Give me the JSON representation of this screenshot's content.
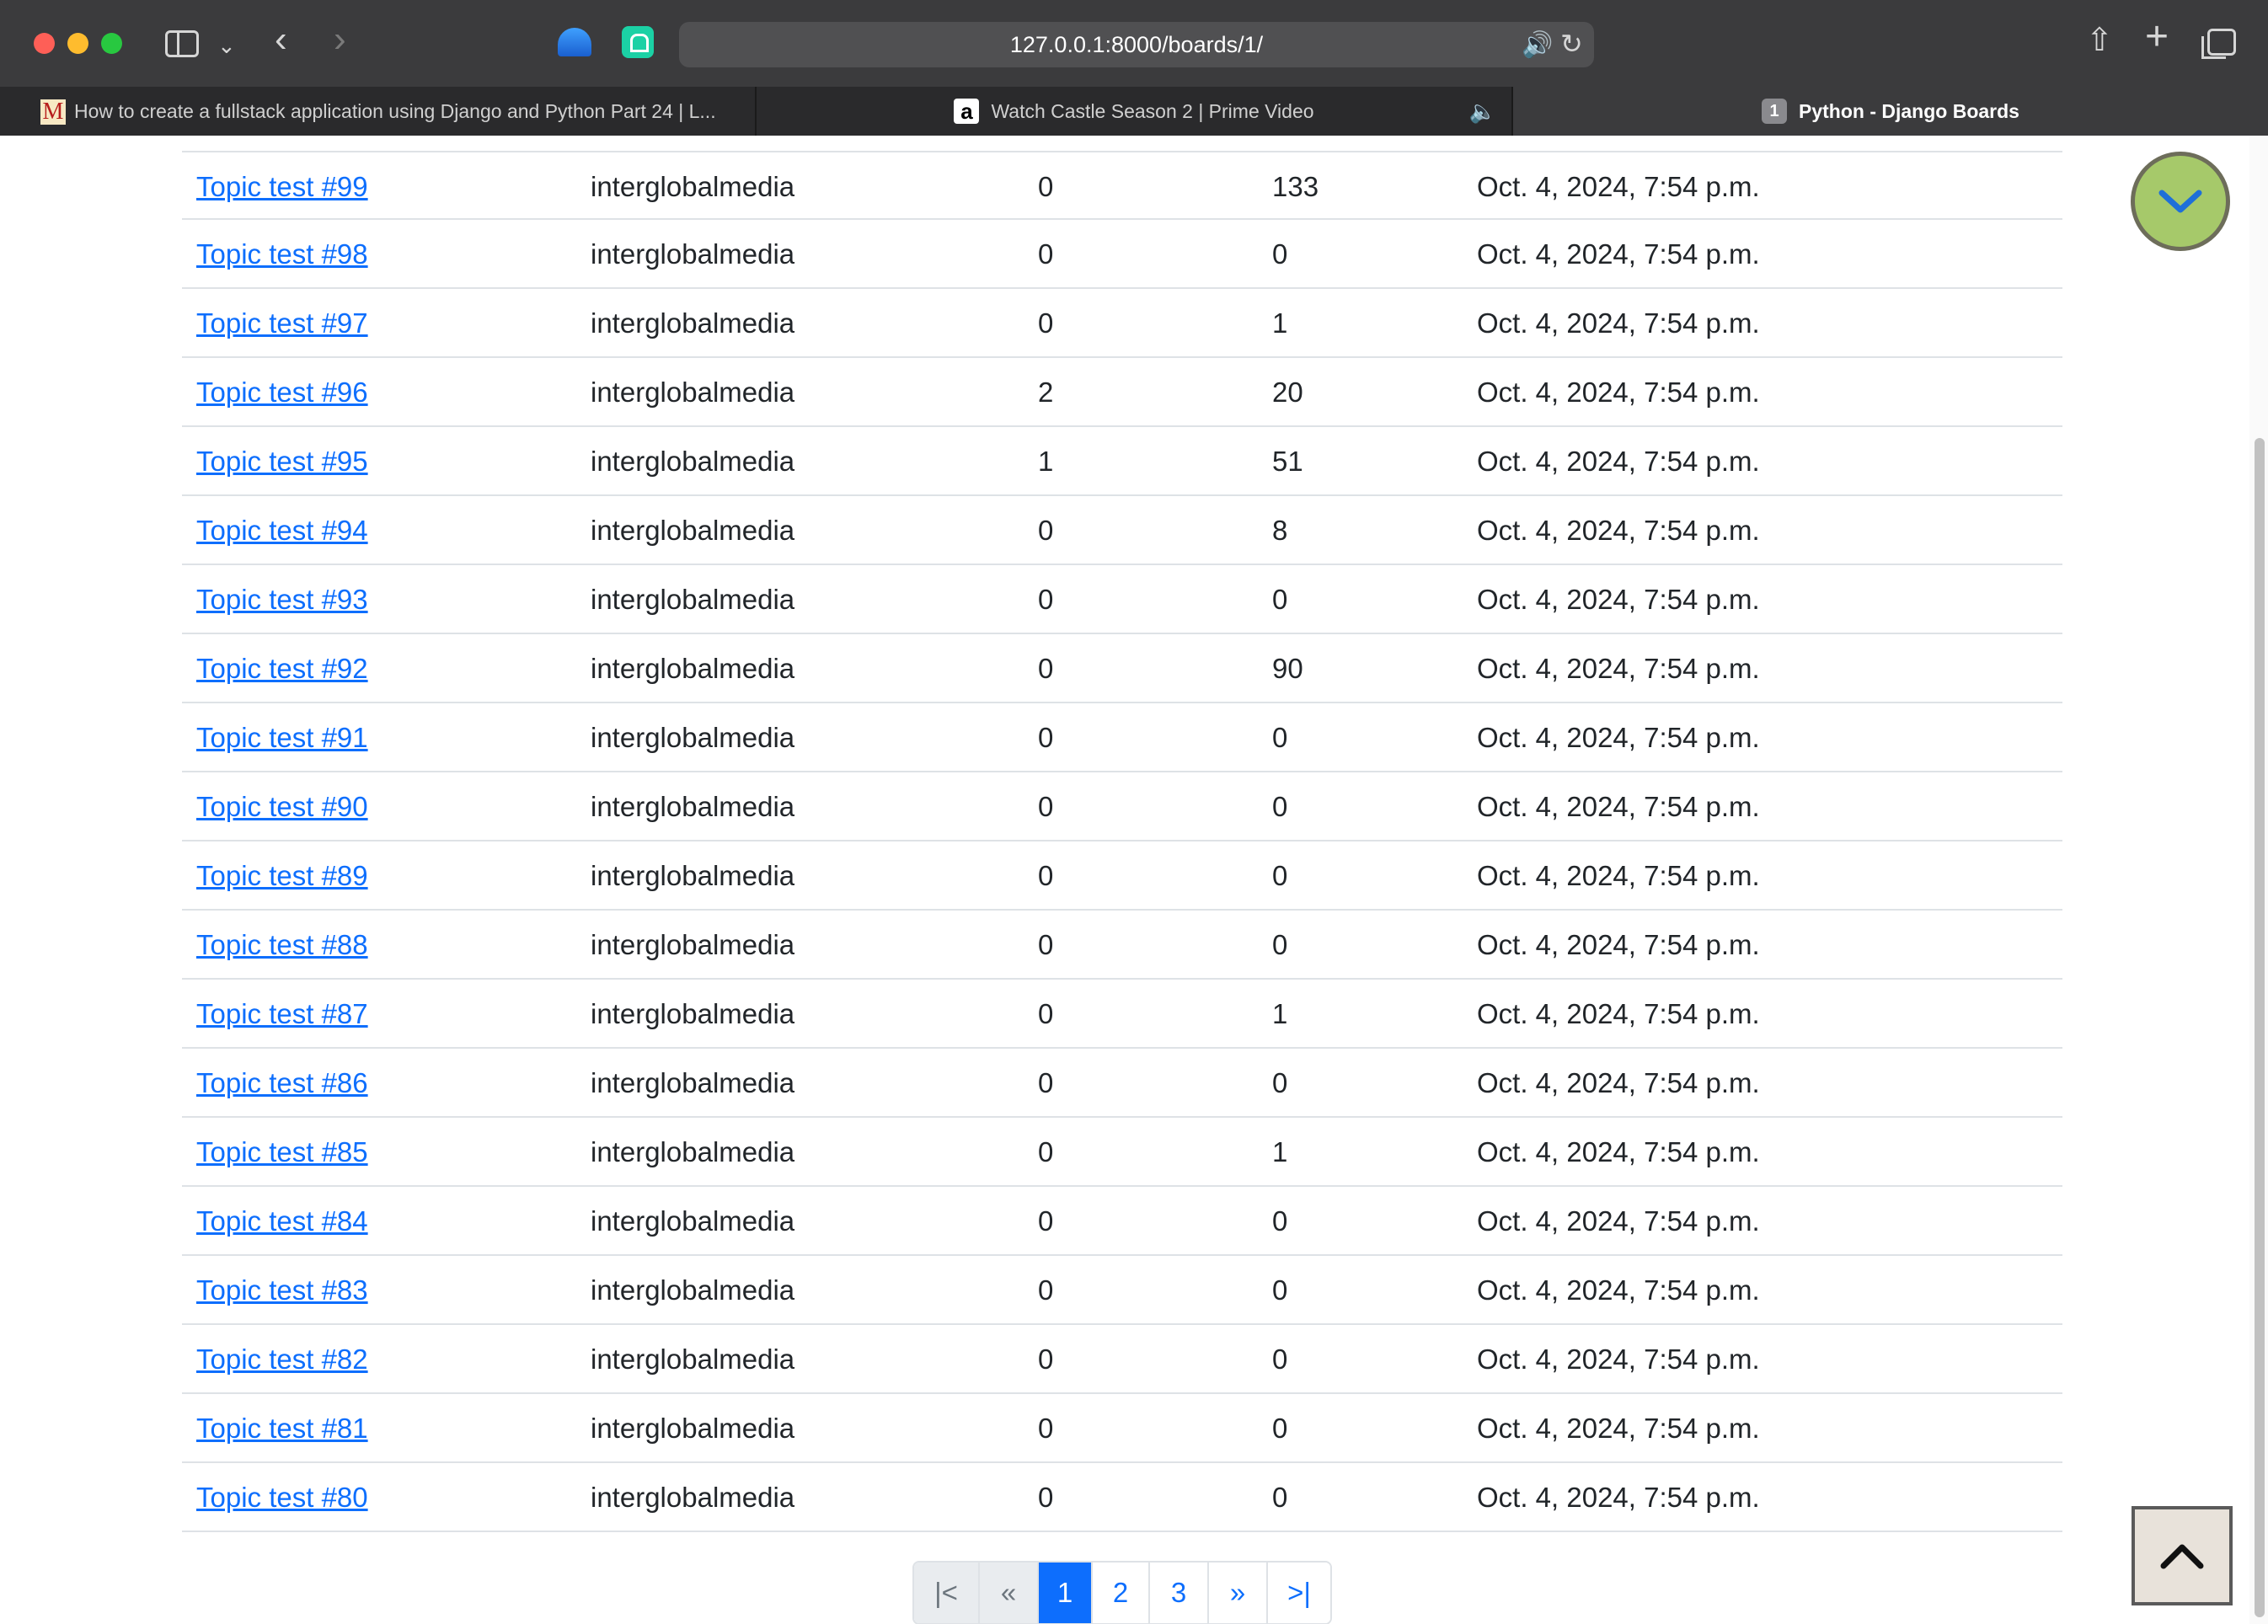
{
  "browser": {
    "url": "127.0.0.1:8000/boards/1/",
    "tabs": [
      {
        "title": "How to create a fullstack application using Django and Python Part 24 | L...",
        "favicon": "M"
      },
      {
        "title": "Watch Castle Season 2 | Prime Video",
        "favicon": "a",
        "audio": true
      },
      {
        "title": "Python - Django Boards",
        "favicon": "1",
        "active": true
      }
    ],
    "icons": [
      "sidebar-icon",
      "chevron-down-icon",
      "back-icon",
      "forward-icon",
      "share-icon",
      "new-tab-icon",
      "tab-overview-icon",
      "speaker-icon",
      "reload-icon"
    ]
  },
  "topics": [
    {
      "subject": "Topic test #99",
      "starter": "interglobalmedia",
      "replies": "0",
      "views": "133",
      "last_update": "Oct. 4, 2024, 7:54 p.m."
    },
    {
      "subject": "Topic test #98",
      "starter": "interglobalmedia",
      "replies": "0",
      "views": "0",
      "last_update": "Oct. 4, 2024, 7:54 p.m."
    },
    {
      "subject": "Topic test #97",
      "starter": "interglobalmedia",
      "replies": "0",
      "views": "1",
      "last_update": "Oct. 4, 2024, 7:54 p.m."
    },
    {
      "subject": "Topic test #96",
      "starter": "interglobalmedia",
      "replies": "2",
      "views": "20",
      "last_update": "Oct. 4, 2024, 7:54 p.m."
    },
    {
      "subject": "Topic test #95",
      "starter": "interglobalmedia",
      "replies": "1",
      "views": "51",
      "last_update": "Oct. 4, 2024, 7:54 p.m."
    },
    {
      "subject": "Topic test #94",
      "starter": "interglobalmedia",
      "replies": "0",
      "views": "8",
      "last_update": "Oct. 4, 2024, 7:54 p.m."
    },
    {
      "subject": "Topic test #93",
      "starter": "interglobalmedia",
      "replies": "0",
      "views": "0",
      "last_update": "Oct. 4, 2024, 7:54 p.m."
    },
    {
      "subject": "Topic test #92",
      "starter": "interglobalmedia",
      "replies": "0",
      "views": "90",
      "last_update": "Oct. 4, 2024, 7:54 p.m."
    },
    {
      "subject": "Topic test #91",
      "starter": "interglobalmedia",
      "replies": "0",
      "views": "0",
      "last_update": "Oct. 4, 2024, 7:54 p.m."
    },
    {
      "subject": "Topic test #90",
      "starter": "interglobalmedia",
      "replies": "0",
      "views": "0",
      "last_update": "Oct. 4, 2024, 7:54 p.m."
    },
    {
      "subject": "Topic test #89",
      "starter": "interglobalmedia",
      "replies": "0",
      "views": "0",
      "last_update": "Oct. 4, 2024, 7:54 p.m."
    },
    {
      "subject": "Topic test #88",
      "starter": "interglobalmedia",
      "replies": "0",
      "views": "0",
      "last_update": "Oct. 4, 2024, 7:54 p.m."
    },
    {
      "subject": "Topic test #87",
      "starter": "interglobalmedia",
      "replies": "0",
      "views": "1",
      "last_update": "Oct. 4, 2024, 7:54 p.m."
    },
    {
      "subject": "Topic test #86",
      "starter": "interglobalmedia",
      "replies": "0",
      "views": "0",
      "last_update": "Oct. 4, 2024, 7:54 p.m."
    },
    {
      "subject": "Topic test #85",
      "starter": "interglobalmedia",
      "replies": "0",
      "views": "1",
      "last_update": "Oct. 4, 2024, 7:54 p.m."
    },
    {
      "subject": "Topic test #84",
      "starter": "interglobalmedia",
      "replies": "0",
      "views": "0",
      "last_update": "Oct. 4, 2024, 7:54 p.m."
    },
    {
      "subject": "Topic test #83",
      "starter": "interglobalmedia",
      "replies": "0",
      "views": "0",
      "last_update": "Oct. 4, 2024, 7:54 p.m."
    },
    {
      "subject": "Topic test #82",
      "starter": "interglobalmedia",
      "replies": "0",
      "views": "0",
      "last_update": "Oct. 4, 2024, 7:54 p.m."
    },
    {
      "subject": "Topic test #81",
      "starter": "interglobalmedia",
      "replies": "0",
      "views": "0",
      "last_update": "Oct. 4, 2024, 7:54 p.m."
    },
    {
      "subject": "Topic test #80",
      "starter": "interglobalmedia",
      "replies": "0",
      "views": "0",
      "last_update": "Oct. 4, 2024, 7:54 p.m."
    }
  ],
  "pagination": {
    "first": "|<",
    "prev": "«",
    "pages": [
      "1",
      "2",
      "3"
    ],
    "current": "1",
    "next": "»",
    "last": ">|"
  },
  "floating": {
    "scroll_down_icon": "chevron-down-icon",
    "scroll_up_icon": "chevron-up-icon",
    "accent": "#a6c96a"
  },
  "colors": {
    "link": "#0d6efd",
    "chrome": "#3b3b3d"
  }
}
